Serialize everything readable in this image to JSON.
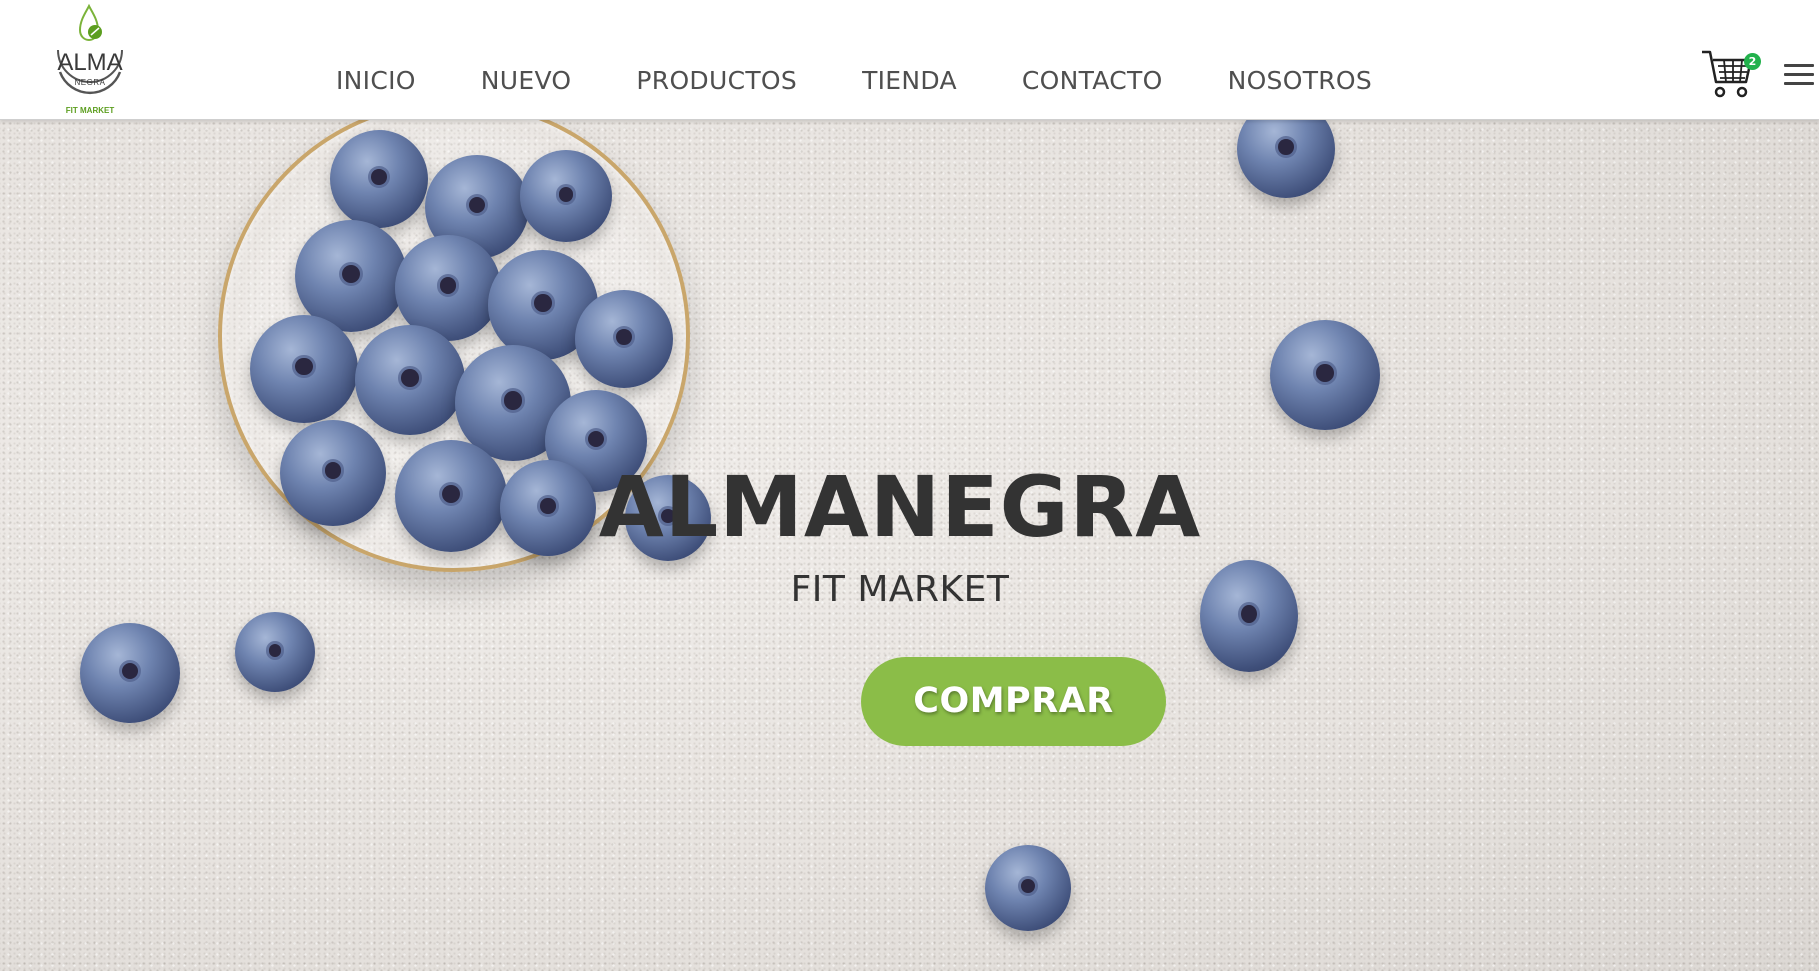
{
  "brand": {
    "logo_main": "ALMA",
    "logo_sub": "NEGRA",
    "logo_tag": "FIT MARKET",
    "accent_green": "#8bbd48",
    "leaf_green": "#5c9e1f"
  },
  "nav": {
    "items": [
      {
        "label": "INICIO"
      },
      {
        "label": "NUEVO"
      },
      {
        "label": "PRODUCTOS"
      },
      {
        "label": "TIENDA"
      },
      {
        "label": "CONTACTO"
      },
      {
        "label": "NOSOTROS"
      }
    ]
  },
  "cart": {
    "icon": "shopping-cart-icon",
    "count": "2",
    "badge_color": "#22b14c"
  },
  "menu": {
    "icon": "hamburger-menu-icon"
  },
  "hero": {
    "title": "ALMANEGRA",
    "subtitle": "FIT MARKET",
    "cta_label": "COMPRAR",
    "background": "blueberries-on-stone-photo"
  }
}
